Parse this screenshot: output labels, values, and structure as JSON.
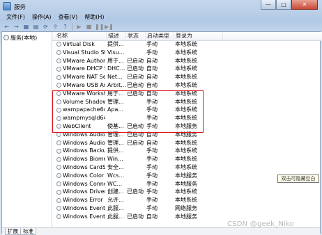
{
  "window": {
    "title": "服务",
    "buttons": [
      "—",
      "□",
      "✕"
    ]
  },
  "menubar": [
    "文件(F)",
    "操作(A)",
    "查看(V)",
    "帮助(H)"
  ],
  "toolbar": {
    "icons": [
      {
        "name": "back-icon",
        "glyph": "←"
      },
      {
        "name": "forward-icon",
        "glyph": "→"
      },
      {
        "name": "console-icon",
        "glyph": "▦"
      },
      {
        "name": "properties-icon",
        "glyph": "▤"
      },
      {
        "name": "refresh-icon",
        "glyph": "⟳"
      },
      {
        "name": "export-icon",
        "glyph": "⇪"
      },
      {
        "name": "help-icon",
        "glyph": "?"
      },
      {
        "name": "separator"
      },
      {
        "name": "play-icon",
        "glyph": "▶"
      },
      {
        "name": "stop-icon",
        "glyph": "■"
      },
      {
        "name": "pause-icon",
        "glyph": "❚❚"
      },
      {
        "name": "restart-icon",
        "glyph": "▶❚"
      }
    ]
  },
  "tree": {
    "root_label": "服务(本地)"
  },
  "columns": [
    "名称",
    "描述",
    "状态",
    "启动类型",
    "登录为"
  ],
  "rows": [
    [
      "Virtual Disk",
      "提供...",
      "",
      "手动",
      "本地系统"
    ],
    [
      "Visual Studio Sta...",
      "Visu...",
      "",
      "手动",
      "本地系统"
    ],
    [
      "VMware Authori...",
      "用于...",
      "已启动",
      "自动",
      "本地系统"
    ],
    [
      "VMware DHCP S...",
      "DHC...",
      "已启动",
      "自动",
      "本地系统"
    ],
    [
      "VMware NAT Se...",
      "Net...",
      "已启动",
      "自动",
      "本地系统"
    ],
    [
      "VMware USB Ar...",
      "Arbit...",
      "已启动",
      "自动",
      "本地系统"
    ],
    [
      "VMware Workst...",
      "用于...",
      "已启动",
      "自动",
      "本地系统"
    ],
    [
      "Volume Shadow...",
      "管理...",
      "",
      "手动",
      "本地系统"
    ],
    [
      "wampapache64",
      "Apa...",
      "",
      "手动",
      "本地系统"
    ],
    [
      "wampmysqld64",
      "",
      "",
      "手动",
      "本地系统"
    ],
    [
      "WebClient",
      "使基...",
      "已启动",
      "手动",
      "本地服务"
    ],
    [
      "Windows Audio",
      "管理...",
      "已启动",
      "自动",
      "本地服务"
    ],
    [
      "Windows Audio ...",
      "管理...",
      "已启动",
      "自动",
      "本地系统"
    ],
    [
      "Windows Backup",
      "提供...",
      "",
      "手动",
      "本地系统"
    ],
    [
      "Windows Biome...",
      "Win...",
      "",
      "手动",
      "本地系统"
    ],
    [
      "Windows CardS...",
      "安全...",
      "",
      "手动",
      "本地系统"
    ],
    [
      "Windows Color ...",
      "Wcs...",
      "",
      "手动",
      "本地服务"
    ],
    [
      "Windows Conne...",
      "WC...",
      "",
      "手动",
      "本地服务"
    ],
    [
      "Windows Driver ...",
      "创建...",
      "已启动",
      "手动",
      "本地系统"
    ],
    [
      "Windows Error ...",
      "允许...",
      "",
      "手动",
      "本地系统"
    ],
    [
      "Windows Event ...",
      "此服...",
      "",
      "手动",
      "网络服务"
    ],
    [
      "Windows Event ...",
      "此服...",
      "已启动",
      "自动",
      "本地服务"
    ]
  ],
  "tabs": [
    "扩展",
    "标准"
  ],
  "tooltip": "双击可隐藏空白",
  "watermark": "CSDN @geek_Niko",
  "colors": {
    "highlight_border": "#e0111a",
    "titlebar": "#c4d7ec"
  }
}
